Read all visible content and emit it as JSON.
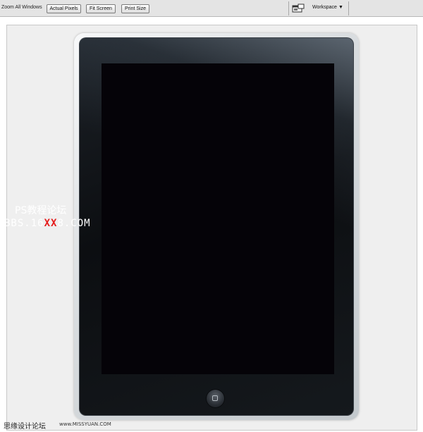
{
  "toolbar": {
    "zoom_all_label": "Zoom All Windows",
    "actual_pixels": "Actual Pixels",
    "fit_screen": "Fit Screen",
    "print_size": "Print Size",
    "workspace_label": "Workspace",
    "workspace_arrow": "▼",
    "workspace_icon": "palette-window-icon"
  },
  "watermark": {
    "line1": "PS教程论坛",
    "line2_prefix": "BBS.16",
    "line2_highlight": "XX",
    "line2_suffix": "8.COM",
    "highlight_color": "#e51b1b"
  },
  "footer": {
    "site_cn": "思缘设计论坛",
    "site_url": "www.MISSYUAN.COM"
  },
  "colors": {
    "canvas_bg": "#efefef",
    "bezel": "#c4c9cd",
    "body": "#0c0e11",
    "screen": "#050308"
  }
}
